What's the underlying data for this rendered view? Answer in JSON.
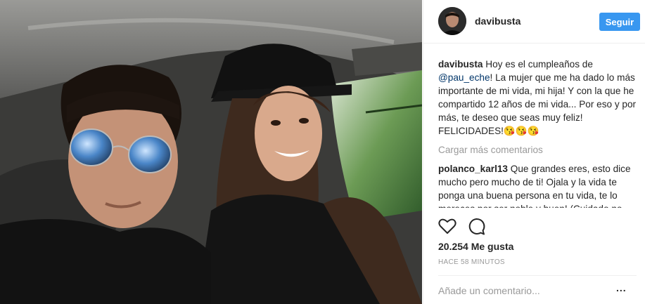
{
  "post": {
    "author": "davibusta",
    "follow_label": "Seguir",
    "caption": {
      "user": "davibusta",
      "text_before": "Hoy es el cumpleaños de ",
      "mention": "@pau_eche",
      "text_after": "! La mujer que me ha dado lo más importante de mi vida, mi hija! Y con la que he compartido 12 años de mi vida... Por eso y por más, te deseo que seas muy feliz! FELICIDADES!😘😘😘"
    },
    "load_more": "Cargar más comentarios",
    "comments": [
      {
        "user": "polanco_karl13",
        "text": "Que grandes eres, esto dice mucho pero mucho de ti! Ojala y la vida te ponga una buena persona en tu vida, te lo mereces por ser noble y buen! (Cuidado no"
      }
    ],
    "likes": "20.254 Me gusta",
    "time_ago": "HACE 58 MINUTOS",
    "comment_placeholder": "Añade un comentario...",
    "more_label": "..."
  },
  "icons": {
    "like": "heart-icon",
    "comment": "comment-bubble-icon",
    "options": "more-options-icon"
  }
}
